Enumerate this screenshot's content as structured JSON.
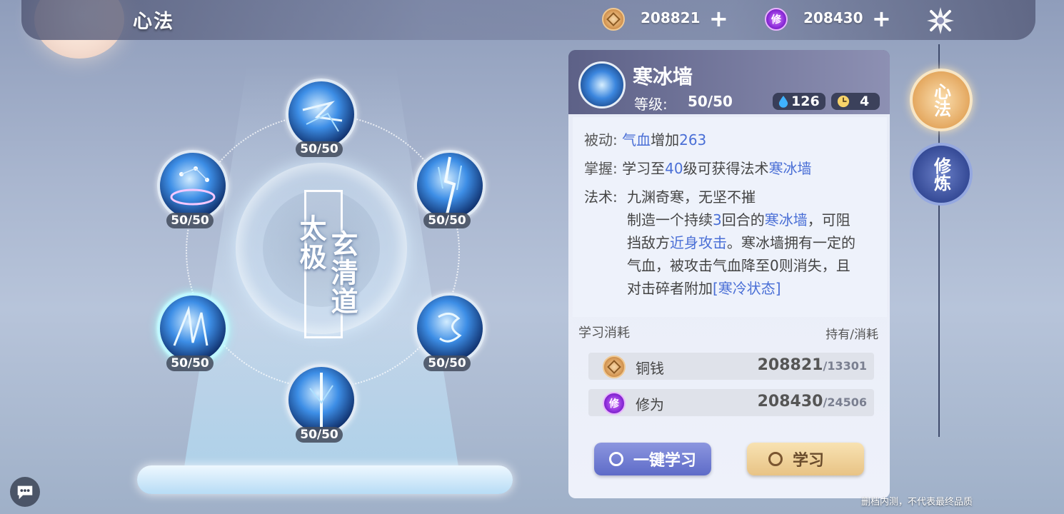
{
  "header": {
    "title": "心法"
  },
  "currency": {
    "copper": {
      "icon": "copper-coin-icon",
      "value": "208821",
      "add": "+"
    },
    "xiuwei": {
      "icon": "xiu-coin-icon",
      "glyph": "修",
      "value": "208430",
      "add": "+"
    }
  },
  "center": {
    "left_text": "太极",
    "right_text": "玄清道"
  },
  "skills": [
    {
      "level": "50/50"
    },
    {
      "level": "50/50"
    },
    {
      "level": "50/50"
    },
    {
      "level": "50/50"
    },
    {
      "level": "50/50"
    },
    {
      "level": "50/50"
    }
  ],
  "detail": {
    "name": "寒冰墙",
    "level_label": "等级:",
    "level_value": "50/50",
    "mana_cost": "126",
    "cooldown": "4",
    "passive_label": "被动:",
    "passive_attr": "气血",
    "passive_mid": "增加",
    "passive_value": "263",
    "master_label": "掌握:",
    "master_pre": "学习至",
    "master_level": "40",
    "master_mid": "级可获得法术",
    "master_spell": "寒冰墙",
    "spell_label": "法术:",
    "spell_line1": "九渊奇寒，无坚不摧",
    "spell_l2_pre": "制造一个持续",
    "spell_l2_num": "3",
    "spell_l2_mid": "回合的",
    "spell_l2_name": "寒冰墙",
    "spell_l2_post": "，可阻",
    "spell_l3_pre": "挡敌方",
    "spell_l3_blue": "近身攻击",
    "spell_l3_post": "。寒冰墙拥有一定的",
    "spell_line4": "气血，被攻击气血降至0则消失，且",
    "spell_l5_pre": "对击碎者附加",
    "spell_l5_blue": "[寒冷状态]"
  },
  "cost": {
    "title": "学习消耗",
    "right_label": "持有/消耗",
    "rows": [
      {
        "icon": "copper-coin-icon",
        "name": "铜钱",
        "have": "208821",
        "need": "/13301"
      },
      {
        "icon": "xiu-coin-icon",
        "glyph": "修",
        "name": "修为",
        "have": "208430",
        "need": "/24506"
      }
    ]
  },
  "buttons": {
    "learn_all": "一键学习",
    "learn": "学习"
  },
  "tabs": {
    "xinfa": "心法",
    "xiulian": "修炼"
  },
  "watermark": "删档内测，不代表最终品质",
  "colors": {
    "accent_blue": "#4a6fd6",
    "gold_button": "#e8c385",
    "blue_button": "#5e6bc8"
  }
}
